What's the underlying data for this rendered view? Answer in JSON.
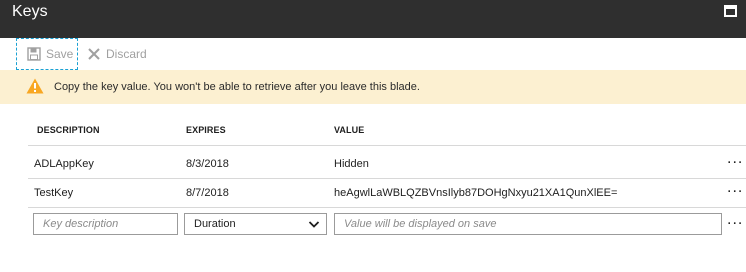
{
  "blade": {
    "title": "Keys"
  },
  "toolbar": {
    "save_label": "Save",
    "discard_label": "Discard"
  },
  "banner": {
    "message": "Copy the key value. You won't be able to retrieve after you leave this blade."
  },
  "table": {
    "headers": {
      "description": "DESCRIPTION",
      "expires": "EXPIRES",
      "value": "VALUE"
    },
    "rows": [
      {
        "description": "ADLAppKey",
        "expires": "8/3/2018",
        "value": "Hidden",
        "more": "..."
      },
      {
        "description": "TestKey",
        "expires": "8/7/2018",
        "value": "heAgwlLaWBLQZBVnsIlyb87DOHgNxyu21XA1QunXlEE=",
        "more": "..."
      }
    ],
    "new_row": {
      "description_placeholder": "Key description",
      "duration_selected": "Duration",
      "value_placeholder": "Value will be displayed on save",
      "more": "..."
    }
  },
  "colors": {
    "title_bar": "#2f2f2f",
    "banner_bg": "#fcf0d1",
    "warning": "#f8a723",
    "focus_outline": "#1aa1d3"
  }
}
